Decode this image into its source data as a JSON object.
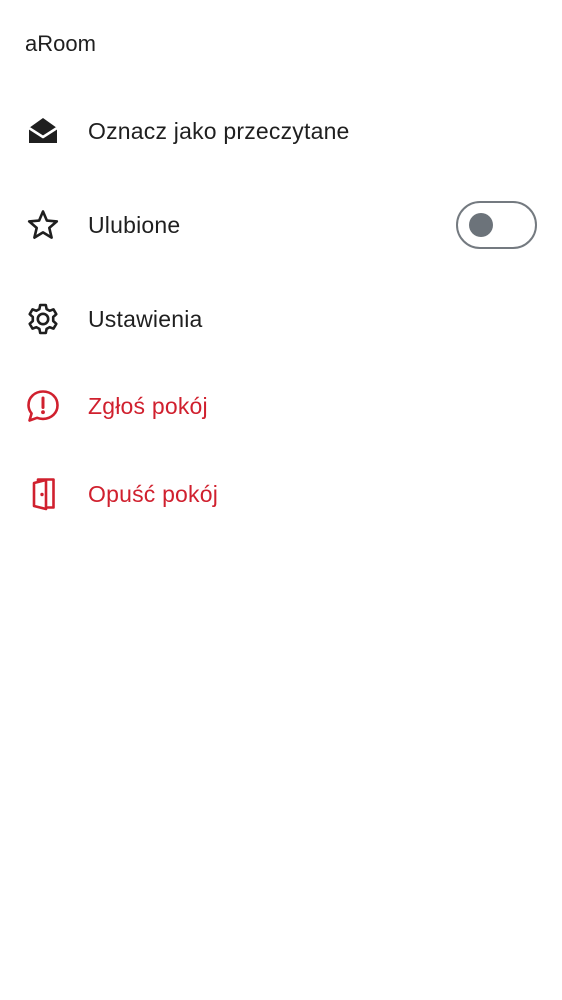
{
  "header": {
    "title": "aRoom"
  },
  "menu": {
    "items": [
      {
        "label": "Oznacz jako przeczytane",
        "icon": "envelope-open-icon"
      },
      {
        "label": "Ulubione",
        "icon": "star-icon",
        "toggle": {
          "checked": false
        }
      },
      {
        "label": "Ustawienia",
        "icon": "gear-icon"
      },
      {
        "label": "Zgłoś pokój",
        "icon": "report-icon"
      },
      {
        "label": "Opuść pokój",
        "icon": "leave-door-icon"
      }
    ]
  },
  "colors": {
    "text": "#1f1f1f",
    "danger": "#d0202e",
    "toggle_border": "#747a80",
    "toggle_knob": "#6c737a",
    "background": "#ffffff"
  }
}
